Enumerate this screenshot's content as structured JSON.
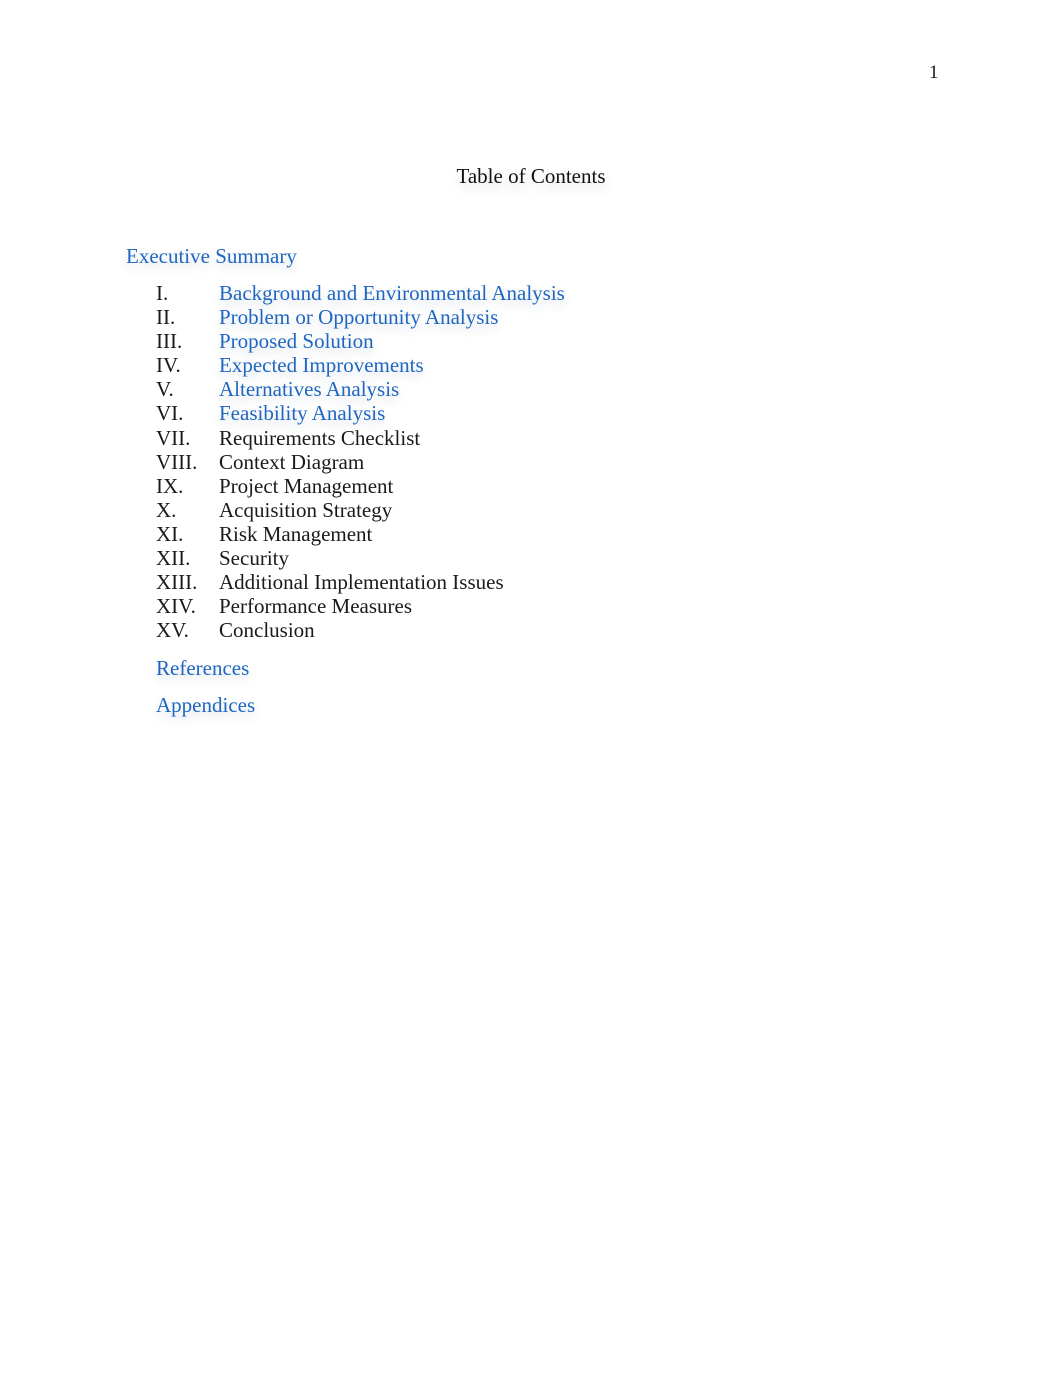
{
  "page": {
    "number": "1"
  },
  "toc": {
    "title": "Table of Contents",
    "executive_summary": "Executive Summary",
    "sections": [
      {
        "numeral": "I.",
        "title": "Background and Environmental Analysis",
        "linked": true
      },
      {
        "numeral": "II.",
        "title": "Problem or Opportunity Analysis",
        "linked": true
      },
      {
        "numeral": "III.",
        "title": "Proposed Solution",
        "linked": true
      },
      {
        "numeral": "IV.",
        "title": "Expected Improvements",
        "linked": true
      },
      {
        "numeral": "V.",
        "title": "Alternatives Analysis",
        "linked": true
      },
      {
        "numeral": "VI.",
        "title": "Feasibility Analysis",
        "linked": true
      },
      {
        "numeral": "VII.",
        "title": "Requirements Checklist",
        "linked": false
      },
      {
        "numeral": "VIII.",
        "title": "Context Diagram",
        "linked": false
      },
      {
        "numeral": "IX.",
        "title": "Project Management",
        "linked": false
      },
      {
        "numeral": "X.",
        "title": "Acquisition Strategy",
        "linked": false
      },
      {
        "numeral": "XI.",
        "title": "Risk Management",
        "linked": false
      },
      {
        "numeral": "XII.",
        "title": "Security",
        "linked": false
      },
      {
        "numeral": "XIII.",
        "title": "Additional Implementation Issues",
        "linked": false
      },
      {
        "numeral": "XIV.",
        "title": "Performance Measures",
        "linked": false
      },
      {
        "numeral": "XV.",
        "title": "Conclusion",
        "linked": false
      }
    ],
    "references": "References",
    "appendices": "Appendices"
  },
  "colors": {
    "link": "#1e66c2",
    "text": "#1a1a1a"
  }
}
